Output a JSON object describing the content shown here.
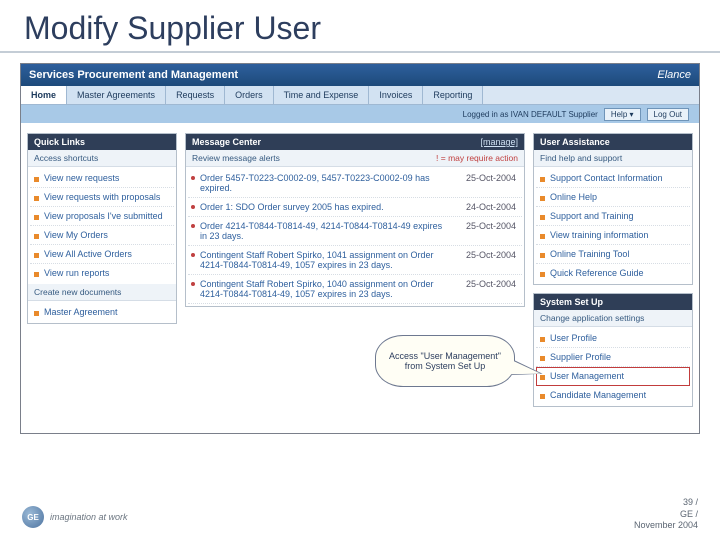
{
  "slide_title": "Modify Supplier User",
  "app": {
    "title": "Services Procurement and Management",
    "brand": "Elance",
    "tabs": [
      "Home",
      "Master Agreements",
      "Requests",
      "Orders",
      "Time and Expense",
      "Invoices",
      "Reporting"
    ],
    "active_tab": 0,
    "loginbar": {
      "text": "Logged in as IVAN DEFAULT Supplier",
      "dropdown": "Help ▾",
      "logout": "Log Out"
    }
  },
  "left": {
    "quick_links": {
      "title": "Quick Links",
      "subtitle": "Access shortcuts",
      "items": [
        "View new requests",
        "View requests with proposals",
        "View proposals I've submitted",
        "View My Orders",
        "View All Active Orders",
        "View run reports"
      ]
    },
    "create_docs": {
      "subtitle": "Create new documents",
      "items": [
        "Master Agreement"
      ]
    }
  },
  "mid": {
    "message_center": {
      "title": "Message Center",
      "manage_link": "[manage]",
      "subtitle_left": "Review message alerts",
      "subtitle_right": "! = may require action",
      "messages": [
        {
          "text": "Order 5457-T0223-C0002-09, 5457-T0223-C0002-09 has expired.",
          "date": "25-Oct-2004"
        },
        {
          "text": "Order 1: SDO Order survey 2005 has expired.",
          "date": "24-Oct-2004"
        },
        {
          "text": "Order 4214-T0844-T0814-49, 4214-T0844-T0814-49 expires in 23 days.",
          "date": "25-Oct-2004"
        },
        {
          "text": "Contingent Staff Robert Spirko, 1041 assignment on Order 4214-T0844-T0814-49, 1057 expires in 23 days.",
          "date": "25-Oct-2004"
        },
        {
          "text": "Contingent Staff Robert Spirko, 1040 assignment on Order 4214-T0844-T0814-49, 1057 expires in 23 days.",
          "date": "25-Oct-2004"
        }
      ]
    },
    "callout": "Access \"User Management\" from System Set Up"
  },
  "right": {
    "user_assistance": {
      "title": "User Assistance",
      "subtitle": "Find help and support",
      "items": [
        "Support Contact Information",
        "Online Help",
        "Support and Training",
        "View training information",
        "Online Training Tool",
        "Quick Reference Guide"
      ]
    },
    "system_setup": {
      "title": "System Set Up",
      "subtitle": "Change application settings",
      "items": [
        "User Profile",
        "Supplier Profile",
        "User Management",
        "Candidate Management"
      ],
      "highlight_index": 2
    }
  },
  "footer": {
    "line1": "39 /",
    "line2": "GE /",
    "line3": "November 2004"
  },
  "ge": {
    "logo_text": "GE",
    "tagline": "imagination at work"
  }
}
